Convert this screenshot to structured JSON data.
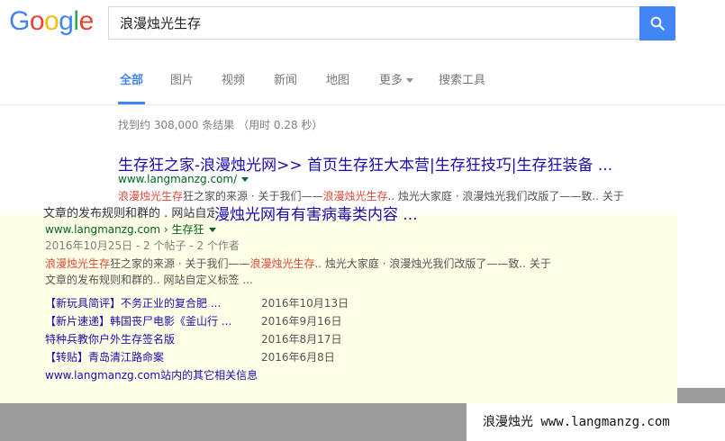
{
  "logo": {
    "text": "Google",
    "letters": [
      "G",
      "o",
      "o",
      "g",
      "l",
      "e"
    ],
    "colors": [
      "#4285f4",
      "#ea4335",
      "#fbbc05",
      "#4285f4",
      "#34a853",
      "#ea4335"
    ]
  },
  "search": {
    "query": "浪漫烛光生存",
    "button_icon": "search-icon"
  },
  "tabs": [
    {
      "label": "全部",
      "active": true
    },
    {
      "label": "图片"
    },
    {
      "label": "视频"
    },
    {
      "label": "新闻"
    },
    {
      "label": "地图"
    },
    {
      "label": "更多"
    },
    {
      "label": "搜索工具"
    }
  ],
  "stats": "找到约 308,000 条结果  （用时 0.28 秒）",
  "result1": {
    "title": "生存狂之家-浪漫烛光网>> 首页生存狂大本营|生存狂技巧|生存狂装备 ...",
    "url": "www.langmanzg.com/",
    "snippet_hl1": "浪漫烛光生存",
    "snippet_mid1": "狂之家的来源 · 关于我们——",
    "snippet_hl2": "浪漫烛光生存",
    "snippet_end": ".. 烛光大家庭 · 浪漫烛光我们改版了——致.. 关于"
  },
  "overlay": {
    "cutoff_text": "文章的发布规则和群的 . 网站自定义标签",
    "title": "漫烛光网有有害病毒类内容 ...",
    "url": "www.langmanzg.com › 生存狂",
    "meta": "2016年10月25日 - 2 个帖子 - 2 个作者",
    "snippet_hl1": "浪漫烛光生存",
    "snippet_mid1": "狂之家的来源 · 关于我们——",
    "snippet_hl2": "浪漫烛光生存",
    "snippet_end1": ".. 烛光大家庭 · 浪漫烛光我们改版了——致.. 关于",
    "snippet_line2": "文章的发布规则和群的.. 网站自定义标签 ...",
    "links": [
      {
        "text": "【新玩具简评】不务正业的复合肥 ...",
        "date": "2016年10月13日"
      },
      {
        "text": "【新片速递】韩国丧尸电影《釜山行 ...",
        "date": "2016年9月16日"
      },
      {
        "text": "特种兵教你户外生存签名版",
        "date": "2016年8月17日"
      },
      {
        "text": "【转贴】青岛清江路命案",
        "date": "2016年6月8日"
      }
    ],
    "more": "www.langmanzg.com站内的其它相关信息"
  },
  "watermark": "浪漫烛光 www.langmanzg.com"
}
